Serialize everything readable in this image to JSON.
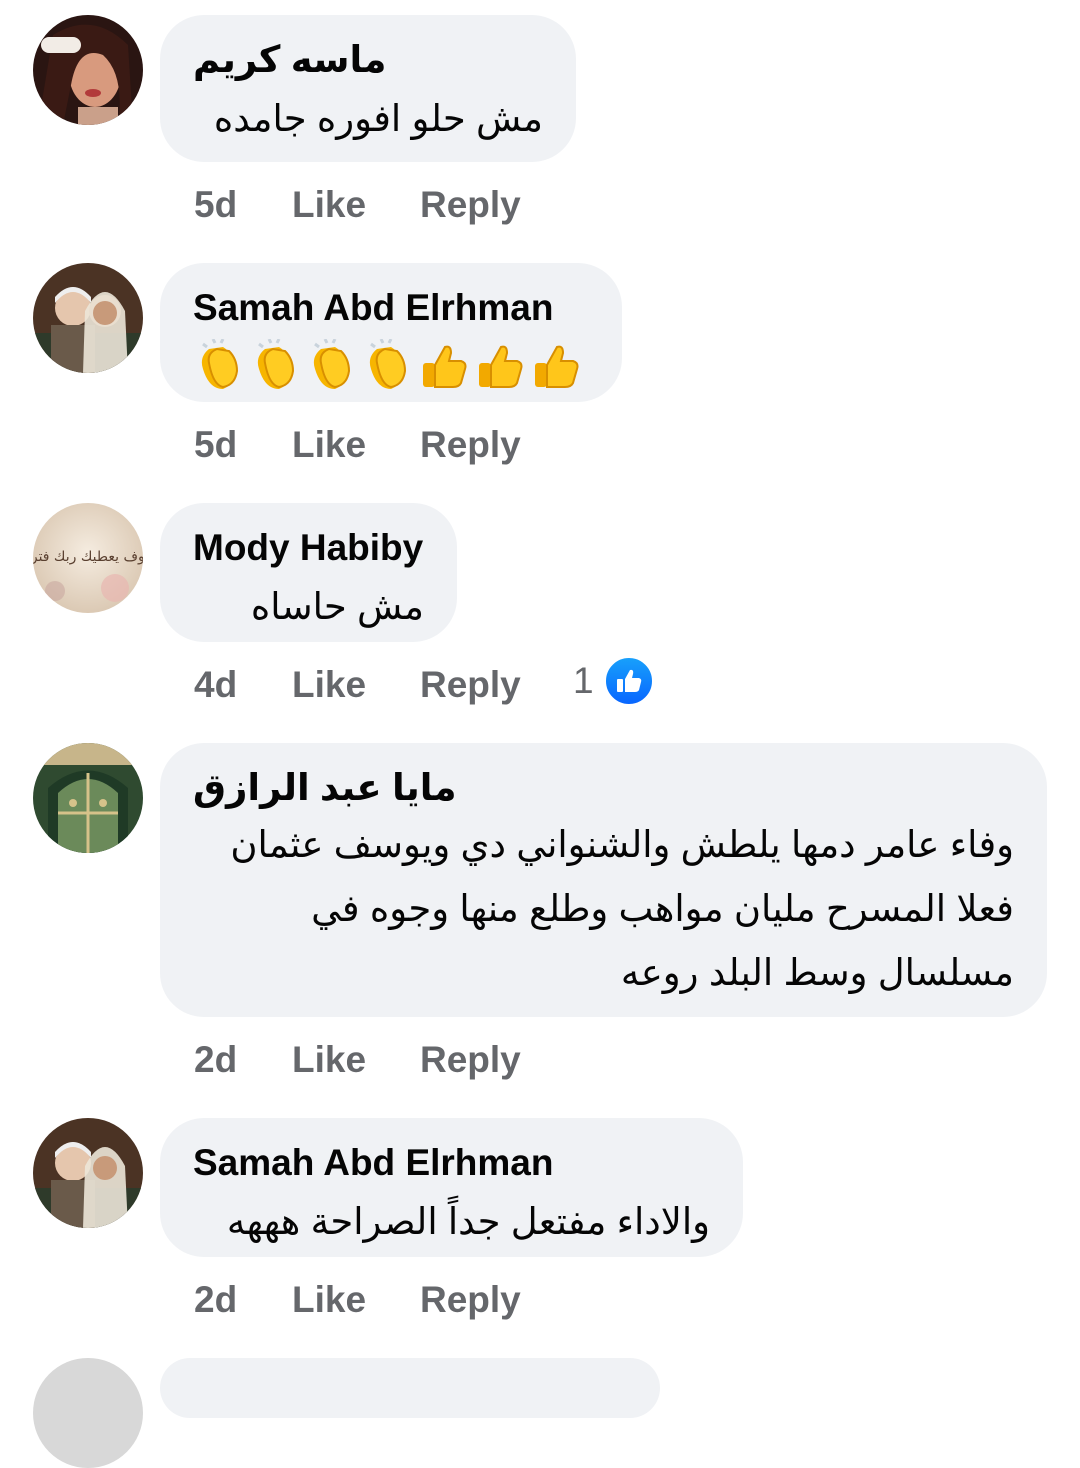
{
  "comments": [
    {
      "author": "ماسه كريم",
      "text": "مش حلو افوره جامده",
      "time": "5d",
      "like": "Like",
      "reply": "Reply"
    },
    {
      "author": "Samah Abd Elrhman",
      "emojis": [
        "clapping-hands",
        "clapping-hands",
        "clapping-hands",
        "clapping-hands",
        "thumbs-up",
        "thumbs-up",
        "thumbs-up"
      ],
      "time": "5d",
      "like": "Like",
      "reply": "Reply"
    },
    {
      "author": "Mody Habiby",
      "text": "مش حاساه",
      "time": "4d",
      "like": "Like",
      "reply": "Reply",
      "reaction_count": "1",
      "avatar_caption": "ولسوف يعطيك ربك فترضى"
    },
    {
      "author": "مايا عبد الرازق",
      "text_lines": [
        "وفاء عامر دمها يلطش والشنواني دي ويوسف عثمان",
        "فعلا المسرح مليان مواهب وطلع منها وجوه في",
        "مسلسال وسط البلد روعه"
      ],
      "time": "2d",
      "like": "Like",
      "reply": "Reply"
    },
    {
      "author": "Samah Abd Elrhman",
      "text": "والاداء مفتعل جداً الصراحة هههه",
      "time": "2d",
      "like": "Like",
      "reply": "Reply"
    }
  ],
  "colors": {
    "bubble": "#f0f2f5",
    "meta_text": "#65676b",
    "like_badge": "#0866ff"
  }
}
